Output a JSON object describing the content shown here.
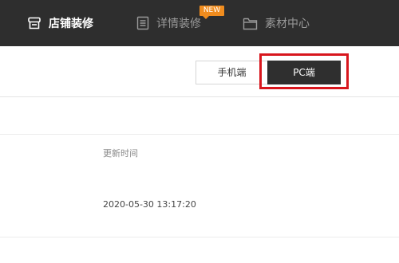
{
  "nav": {
    "items": [
      {
        "label": "店铺装修",
        "icon": "shop-icon",
        "active": true
      },
      {
        "label": "详情装修",
        "icon": "document-icon",
        "active": false,
        "badge": "NEW"
      },
      {
        "label": "素材中心",
        "icon": "folder-icon",
        "active": false
      }
    ]
  },
  "device_toggle": {
    "mobile_label": "手机端",
    "pc_label": "PC端",
    "selected": "PC端"
  },
  "table": {
    "column_header": "更新时间",
    "rows": [
      {
        "updated_at": "2020-05-30 13:17:20"
      }
    ]
  },
  "colors": {
    "topbar_bg": "#2e2e2e",
    "badge": "#f08c1e",
    "highlight": "#d8161d",
    "selected_toggle": "#2f2f2f"
  }
}
